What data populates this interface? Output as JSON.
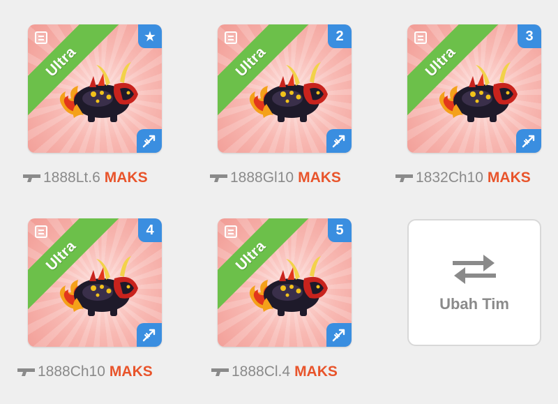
{
  "monsters": [
    {
      "rank": "Ultra",
      "badge": "★",
      "label": "1888Lt.6",
      "status": "MAKS"
    },
    {
      "rank": "Ultra",
      "badge": "2",
      "label": "1888Gl10",
      "status": "MAKS"
    },
    {
      "rank": "Ultra",
      "badge": "3",
      "label": "1832Ch10",
      "status": "MAKS"
    },
    {
      "rank": "Ultra",
      "badge": "4",
      "label": "1888Ch10",
      "status": "MAKS"
    },
    {
      "rank": "Ultra",
      "badge": "5",
      "label": "1888Cl.4",
      "status": "MAKS"
    }
  ],
  "swap_team": {
    "label": "Ubah Tim",
    "icon": "swap-arrows-icon"
  },
  "icons": {
    "corner_top_left": "document-icon",
    "corner_bottom_right": "arrow-type-icon",
    "label_prefix": "gun-icon"
  },
  "colors": {
    "ribbon": "#6cc04a",
    "badge": "#3a8ee0",
    "max_text": "#e8542b",
    "card_bg": "#f8b9b3"
  }
}
